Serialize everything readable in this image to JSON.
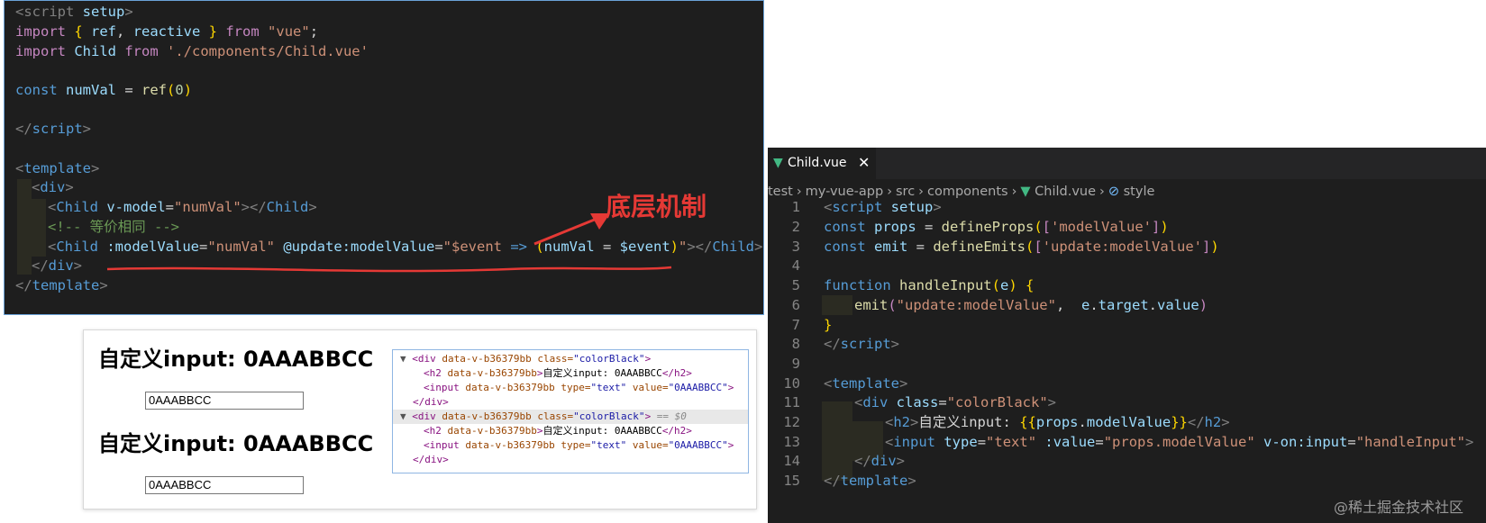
{
  "left_code": {
    "lines": [
      [
        "<script",
        " setup",
        ">"
      ],
      [
        "import",
        "{ ",
        "ref",
        ", ",
        "reactive",
        " }",
        " from",
        "\"vue\"",
        ";"
      ],
      [
        "import",
        " Child",
        " from",
        " './components/Child.vue'"
      ],
      [],
      [
        "const",
        " numVal",
        " = ",
        "ref",
        "(",
        "0",
        ")"
      ],
      [],
      [
        "</",
        "script",
        ">"
      ],
      [],
      [
        "<",
        "template",
        ">"
      ],
      [
        "<",
        "div",
        ">"
      ],
      [
        "<",
        "Child",
        " v-model",
        "=",
        "\"numVal\"",
        "></",
        "Child",
        ">"
      ],
      [
        "<!-- 等价相同 -->"
      ],
      [
        "<",
        "Child",
        " :modelValue",
        "=",
        "\"numVal\"",
        " @update:modelValue",
        "=",
        "\"$event",
        " =>",
        " (",
        "numVal",
        " = ",
        "$event",
        ")",
        "\"",
        "></",
        "Child",
        ">"
      ],
      [
        "</",
        "div",
        ">"
      ],
      [
        "</",
        "template",
        ">"
      ]
    ],
    "annotation": "底层机制"
  },
  "preview": {
    "heading": "自定义input: 0AAABBCC",
    "input_value": "0AAABBCC"
  },
  "devtools": {
    "lines": [
      {
        "indent": 0,
        "tri": "▼",
        "html": [
          "<div ",
          "data-v-b36379bb",
          " class=",
          "\"colorBlack\"",
          ">"
        ]
      },
      {
        "indent": 1,
        "tri": "",
        "html": [
          "<h2 ",
          "data-v-b36379bb",
          "",
          "",
          ">",
          "自定义input: 0AAABBCC",
          "</h2>"
        ]
      },
      {
        "indent": 1,
        "tri": "",
        "html": [
          "<input ",
          "data-v-b36379bb",
          " type=",
          "\"text\"",
          " value=",
          "\"0AAABBCC\"",
          ">"
        ]
      },
      {
        "indent": 0,
        "tri": "",
        "html": [
          "</div>"
        ]
      },
      {
        "indent": 0,
        "tri": "▼",
        "html": [
          "<div ",
          "data-v-b36379bb",
          " class=",
          "\"colorBlack\"",
          ">"
        ],
        "selected": " == $0"
      },
      {
        "indent": 1,
        "tri": "",
        "html": [
          "<h2 ",
          "data-v-b36379bb",
          "",
          "",
          ">",
          "自定义input: 0AAABBCC",
          "</h2>"
        ]
      },
      {
        "indent": 1,
        "tri": "",
        "html": [
          "<input ",
          "data-v-b36379bb",
          " type=",
          "\"text\"",
          " value=",
          "\"0AAABBCC\"",
          ">"
        ]
      },
      {
        "indent": 0,
        "tri": "",
        "html": [
          "</div>"
        ]
      }
    ]
  },
  "editor": {
    "tab_label": "Child.vue",
    "tab_close": "✕",
    "breadcrumb": [
      "test",
      "my-vue-app",
      "src",
      "components",
      "Child.vue",
      "style"
    ],
    "line_numbers": [
      "1",
      "2",
      "3",
      "4",
      "5",
      "6",
      "7",
      "8",
      "9",
      "10",
      "11",
      "12",
      "13",
      "14",
      "15"
    ],
    "lines": [
      [
        "<",
        "script",
        " setup",
        ">"
      ],
      [
        "const",
        " props",
        " = ",
        "defineProps",
        "(",
        "[",
        "'modelValue'",
        "]",
        ")"
      ],
      [
        "const",
        " emit",
        " = ",
        "defineEmits",
        "(",
        "[",
        "'update:modelValue'",
        "]",
        ")"
      ],
      [],
      [
        "function",
        " handleInput",
        "(",
        "e",
        ")",
        " {"
      ],
      [
        "emit",
        "(",
        "\"update:modelValue\"",
        ",  ",
        "e",
        ".",
        "target",
        ".",
        "value",
        ")"
      ],
      [
        "}"
      ],
      [
        "</",
        "script",
        ">"
      ],
      [],
      [
        "<",
        "template",
        ">"
      ],
      [
        "<",
        "div",
        " class",
        "=",
        "\"colorBlack\"",
        ">"
      ],
      [
        "<",
        "h2",
        ">",
        "自定义input: ",
        "{{",
        "props",
        ".",
        "modelValue",
        "}}",
        "</",
        "h2",
        ">"
      ],
      [
        "<",
        "input",
        " type",
        "=",
        "\"text\"",
        " :value",
        "=",
        "\"props.modelValue\"",
        " v-on:input",
        "=",
        "\"handleInput\"",
        ">"
      ],
      [
        "</",
        "div",
        ">"
      ],
      [
        "</",
        "template",
        ">"
      ]
    ]
  },
  "watermark": "@稀土掘金技术社区",
  "colors": {
    "editor_bg": "#1e1e1e",
    "vue_green": "#42b883",
    "annotation_red": "#e53935"
  }
}
